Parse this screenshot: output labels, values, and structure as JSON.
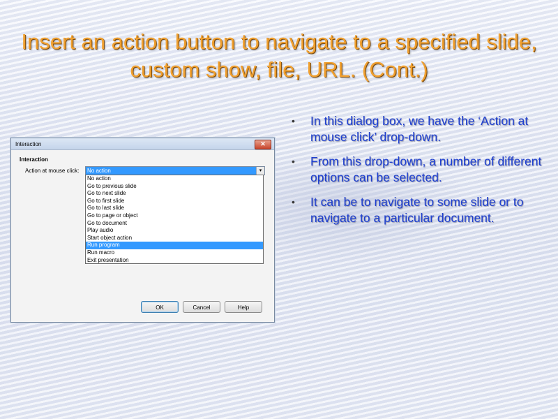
{
  "slide": {
    "title": "Insert an action button to navigate to a specified slide, custom show, file, URL. (Cont.)",
    "bullets": [
      "In this dialog box, we have the ‘Action at mouse click’ drop-down.",
      "From this drop-down, a number of different options can be selected.",
      "It can be to navigate to some slide or to navigate to a particular document."
    ],
    "bullet_glyph": "•"
  },
  "dialog": {
    "title": "Interaction",
    "close_glyph": "✕",
    "section_label": "Interaction",
    "action_label": "Action at mouse click:",
    "selected_value": "No action",
    "dropdown_arrow": "▾",
    "options": [
      "No action",
      "Go to previous slide",
      "Go to next slide",
      "Go to first slide",
      "Go to last slide",
      "Go to page or object",
      "Go to document",
      "Play audio",
      "Start object action",
      "Run program",
      "Run macro",
      "Exit presentation"
    ],
    "highlighted_option": "Run program",
    "buttons": {
      "ok": "OK",
      "cancel": "Cancel",
      "help": "Help"
    }
  },
  "colors": {
    "title": "#f0a030",
    "bullet_text": "#1e3fd0",
    "selection": "#3399ff"
  }
}
